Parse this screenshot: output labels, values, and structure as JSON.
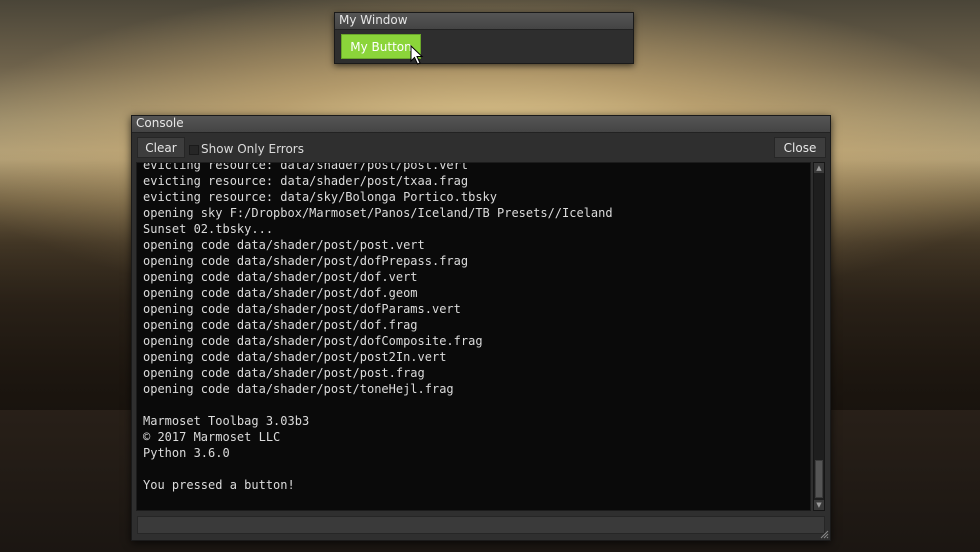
{
  "my_window": {
    "title": "My Window",
    "button_label": "My Button",
    "button_color": "#8bd53a"
  },
  "console": {
    "title": "Console",
    "clear_label": "Clear",
    "show_only_errors_label": "Show Only Errors",
    "show_only_errors_checked": false,
    "close_label": "Close",
    "input_value": "",
    "lines": [
      "evicting resource: data/shader/post/post.vert",
      "evicting resource: data/shader/post/txaa.frag",
      "evicting resource: data/sky/Bolonga Portico.tbsky",
      "opening sky F:/Dropbox/Marmoset/Panos/Iceland/TB Presets//Iceland",
      "Sunset 02.tbsky...",
      "opening code data/shader/post/post.vert",
      "opening code data/shader/post/dofPrepass.frag",
      "opening code data/shader/post/dof.vert",
      "opening code data/shader/post/dof.geom",
      "opening code data/shader/post/dofParams.vert",
      "opening code data/shader/post/dof.frag",
      "opening code data/shader/post/dofComposite.frag",
      "opening code data/shader/post/post2In.vert",
      "opening code data/shader/post/post.frag",
      "opening code data/shader/post/toneHejl.frag",
      "",
      "Marmoset Toolbag 3.03b3",
      "© 2017 Marmoset LLC",
      "Python 3.6.0",
      "",
      "You pressed a button!"
    ]
  },
  "icons": {
    "cursor": "mouse-pointer-icon",
    "scroll_up": "arrow-up-icon",
    "scroll_down": "arrow-down-icon",
    "resize": "resize-grip-icon"
  }
}
